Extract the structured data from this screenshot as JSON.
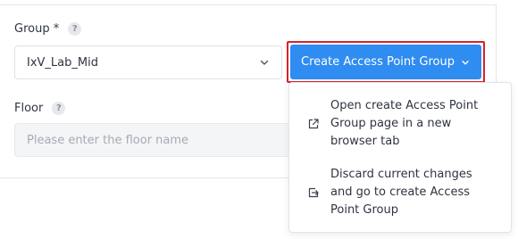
{
  "group": {
    "label": "Group *",
    "help": "?",
    "selected": "IxV_Lab_Mid"
  },
  "floor": {
    "label": "Floor",
    "help": "?",
    "placeholder": "Please enter the floor name"
  },
  "create_button": {
    "label": "Create Access Point Group"
  },
  "dropdown_menu": {
    "items": [
      {
        "label": "Open create Access Point Group page in a new browser tab",
        "icon": "external-link-icon"
      },
      {
        "label": "Discard current changes and go to create Access Point Group",
        "icon": "exit-icon"
      }
    ]
  },
  "colors": {
    "primary": "#2f8cf0",
    "highlight_border": "#d9212a"
  }
}
